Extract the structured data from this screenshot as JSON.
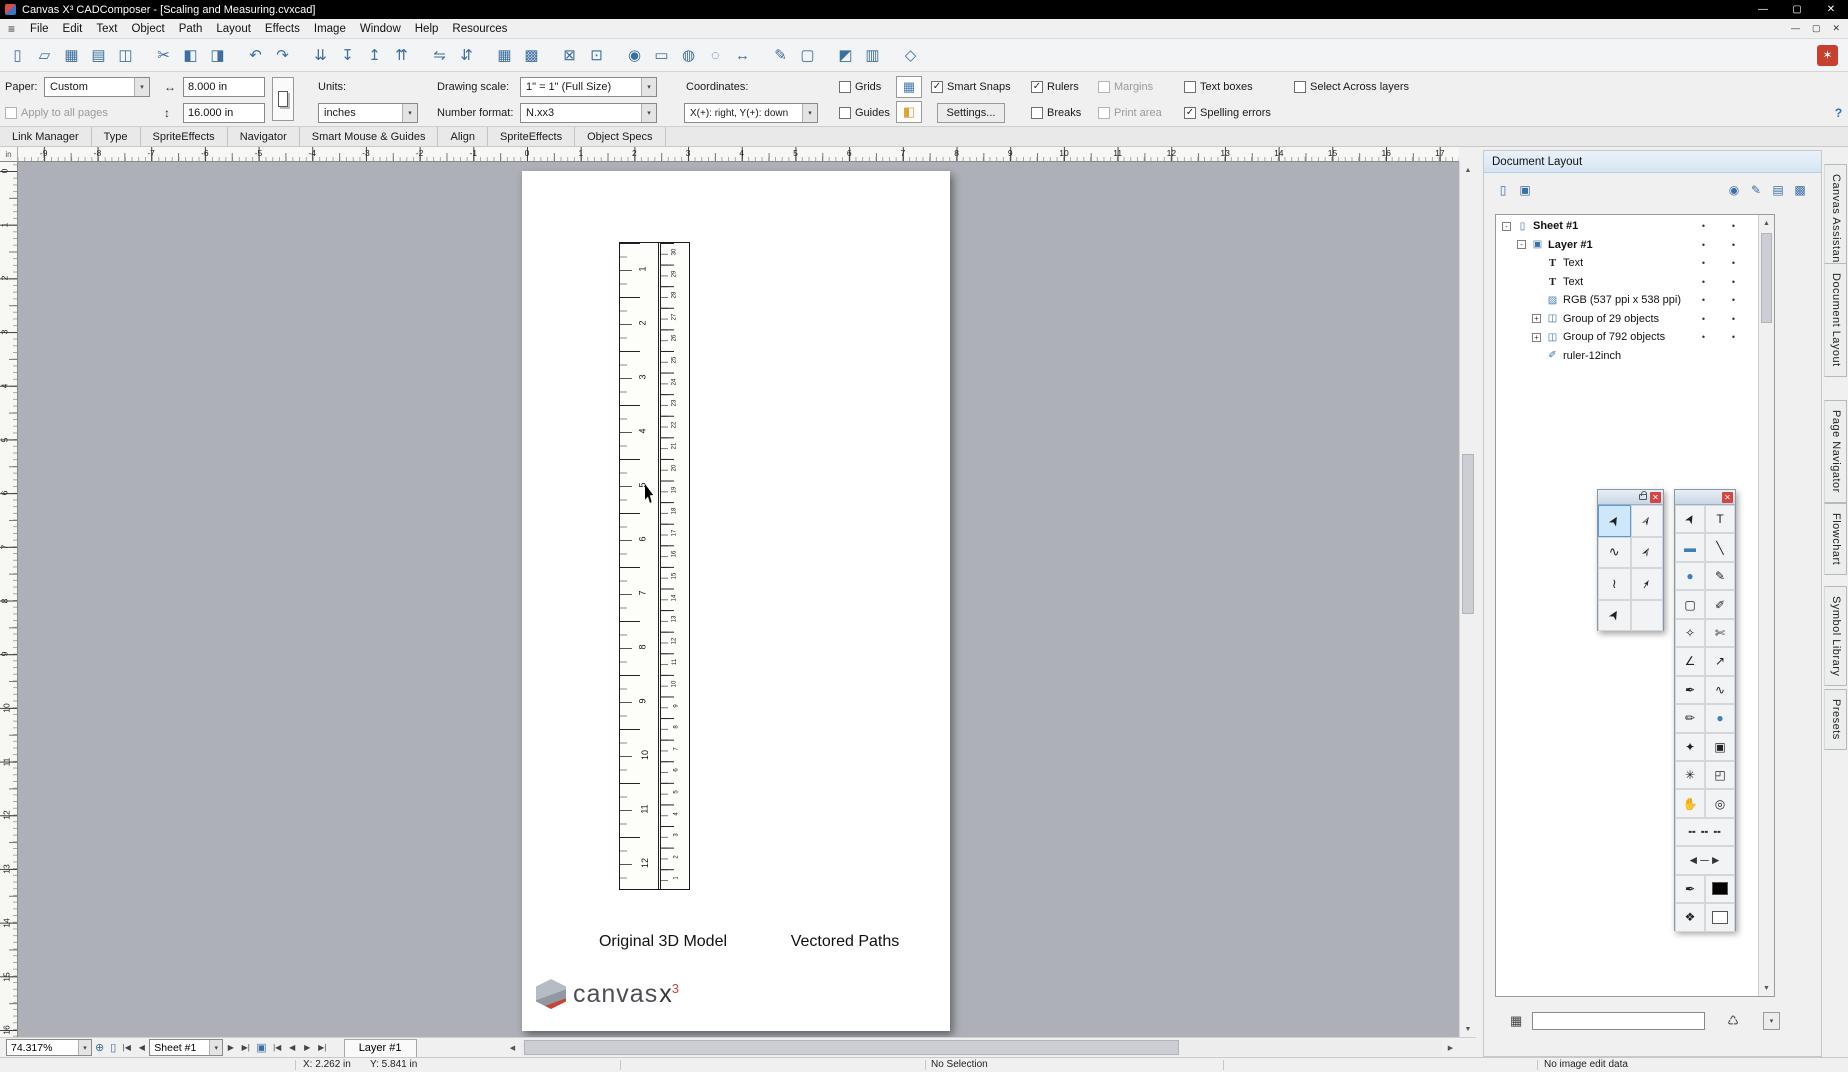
{
  "window": {
    "title": "Canvas X³ CADComposer - [Scaling and Measuring.cvxcad]",
    "controls": {
      "minimize": "—",
      "restore": "▢",
      "close": "✕"
    },
    "doc_controls": {
      "minimize": "—",
      "restore": "▢",
      "close": "✕"
    }
  },
  "menubar": {
    "hamburger": "≡",
    "items": [
      "File",
      "Edit",
      "Text",
      "Object",
      "Path",
      "Layout",
      "Effects",
      "Image",
      "Window",
      "Help",
      "Resources"
    ]
  },
  "toolbar": {
    "logo_glyph": "✶",
    "icons": [
      {
        "name": "new-document-icon",
        "glyph": "▯"
      },
      {
        "name": "open-file-icon",
        "glyph": "▱"
      },
      {
        "name": "save-icon",
        "glyph": "▦"
      },
      {
        "name": "print-icon",
        "glyph": "▤"
      },
      {
        "name": "print-preview-icon",
        "glyph": "◫"
      },
      {
        "name": "cut-icon",
        "glyph": "✂",
        "gap": true
      },
      {
        "name": "copy-icon",
        "glyph": "◧"
      },
      {
        "name": "paste-icon",
        "glyph": "◨"
      },
      {
        "name": "undo-icon",
        "glyph": "↶",
        "gap": true
      },
      {
        "name": "redo-icon",
        "glyph": "↷"
      },
      {
        "name": "send-to-back-icon",
        "glyph": "⇊",
        "gap": true
      },
      {
        "name": "send-backward-icon",
        "glyph": "↧"
      },
      {
        "name": "bring-forward-icon",
        "glyph": "↥"
      },
      {
        "name": "bring-to-front-icon",
        "glyph": "⇈"
      },
      {
        "name": "flip-horizontal-icon",
        "glyph": "⇋",
        "gap": true
      },
      {
        "name": "flip-vertical-icon",
        "glyph": "⇵"
      },
      {
        "name": "tile-horizontal-icon",
        "glyph": "▦",
        "gap": true
      },
      {
        "name": "tile-vertical-icon",
        "glyph": "▩"
      },
      {
        "name": "lock-icon",
        "glyph": "⊠",
        "gap": true
      },
      {
        "name": "unlock-icon",
        "glyph": "⊡"
      },
      {
        "name": "inspect-icon",
        "glyph": "◉",
        "gap": true
      },
      {
        "name": "select-area-icon",
        "glyph": "▭"
      },
      {
        "name": "fill-globe-icon",
        "glyph": "◍"
      },
      {
        "name": "zoom-area-icon",
        "glyph": "◌"
      },
      {
        "name": "fit-width-icon",
        "glyph": "↔"
      },
      {
        "name": "annotate-icon",
        "glyph": "✎",
        "gap": true
      },
      {
        "name": "screen-share-icon",
        "glyph": "▢"
      },
      {
        "name": "gradient-icon",
        "glyph": "◩",
        "gap": true
      },
      {
        "name": "chart-icon",
        "glyph": "▥"
      },
      {
        "name": "view-3d-icon",
        "glyph": "◇",
        "gap": true
      }
    ]
  },
  "properties": {
    "paper_label": "Paper:",
    "paper_value": "Custom",
    "width_icon": "↔",
    "height_icon": "↕",
    "width_value": "8.000 in",
    "height_value": "16.000 in",
    "apply_checkbox": {
      "label": "Apply to all pages",
      "checked": false,
      "disabled": true
    },
    "units_label": "Units:",
    "units_value": "inches",
    "scale_label": "Drawing scale:",
    "scale_value": "1\" = 1\"  (Full Size)",
    "format_label": "Number format:",
    "format_value": "N.xx3",
    "coords_label": "Coordinates:",
    "coords_value": "X(+): right, Y(+): down",
    "grid_icon": "▦",
    "snap_icon": "◧",
    "settings_label": "Settings...",
    "help_label": "?",
    "checkboxes_row1": [
      {
        "label": "Grids",
        "checked": false
      },
      {
        "label": "Smart Snaps",
        "checked": true
      },
      {
        "label": "Rulers",
        "checked": true
      },
      {
        "label": "Margins",
        "checked": false,
        "disabled": true
      },
      {
        "label": "Text boxes",
        "checked": false
      },
      {
        "label": "Select Across layers",
        "checked": false
      }
    ],
    "checkboxes_row2": [
      {
        "label": "Guides",
        "checked": false
      },
      {
        "label": "Breaks",
        "checked": false
      },
      {
        "label": "Print area",
        "checked": false,
        "disabled": true
      },
      {
        "label": "Spelling errors",
        "checked": true
      }
    ]
  },
  "palette_tabs": [
    "Link Manager",
    "Type",
    "SpriteEffects",
    "Navigator",
    "Smart Mouse & Guides",
    "Align",
    "SpriteEffects",
    "Object Specs"
  ],
  "rulers": {
    "unit": "in",
    "horizontal": [
      -9,
      -8,
      -7,
      -6,
      -5,
      -4,
      -3,
      -2,
      -1,
      0,
      1,
      2,
      3,
      4,
      5,
      6,
      7,
      8,
      9,
      10,
      11,
      12,
      13,
      14,
      15,
      16,
      17
    ],
    "vertical": [
      0,
      1,
      2,
      3,
      4,
      5,
      6,
      7,
      8,
      9,
      10,
      11,
      12,
      13,
      14,
      15,
      16
    ]
  },
  "canvas": {
    "captions": {
      "left": "Original 3D Model",
      "right": "Vectored Paths"
    },
    "logo": {
      "text": "canvas",
      "x": "x",
      "sup": "3"
    },
    "ruler_object": {
      "inches": [
        1,
        2,
        3,
        4,
        5,
        6,
        7,
        8,
        9,
        10,
        11,
        12
      ],
      "cm": [
        30,
        29,
        28,
        27,
        26,
        25,
        24,
        23,
        22,
        21,
        20,
        19,
        18,
        17,
        16,
        15,
        14,
        13,
        12,
        11,
        10,
        9,
        8,
        7,
        6,
        5,
        4,
        3,
        2,
        1
      ]
    }
  },
  "document_layout_panel": {
    "title": "Document Layout",
    "header_icons_left": [
      {
        "name": "new-item-icon",
        "glyph": "▯"
      },
      {
        "name": "duplicate-item-icon",
        "glyph": "▣"
      }
    ],
    "header_icons_right": [
      {
        "name": "visibility-icon",
        "glyph": "◉"
      },
      {
        "name": "edit-icon",
        "glyph": "✎"
      },
      {
        "name": "print-item-icon",
        "glyph": "▤"
      },
      {
        "name": "colors-icon",
        "glyph": "▩"
      }
    ],
    "icon_glyphs": {
      "sheet": "▯",
      "layer": "▣",
      "text": "T",
      "image": "▨",
      "group": "◫",
      "vector": "✐"
    },
    "tree": [
      {
        "label": "Sheet #1",
        "indent": 0,
        "icon": "sheet",
        "bold": true,
        "expander": "minus",
        "dots": true
      },
      {
        "label": "Layer #1",
        "indent": 1,
        "icon": "layer",
        "bold": true,
        "expander": "minus",
        "dots": true
      },
      {
        "label": "Text",
        "indent": 2,
        "icon": "text",
        "dots": true
      },
      {
        "label": "Text",
        "indent": 2,
        "icon": "text",
        "dots": true
      },
      {
        "label": "RGB (537 ppi x 538 ppi)",
        "indent": 2,
        "icon": "image",
        "dots": true
      },
      {
        "label": "Group of 29 objects",
        "indent": 2,
        "icon": "group",
        "expander": "plus",
        "dots": true
      },
      {
        "label": "Group of 792 objects",
        "indent": 2,
        "icon": "group",
        "expander": "plus",
        "dots": true
      },
      {
        "label": "ruler-12inch",
        "indent": 2,
        "icon": "vector",
        "dots": false
      }
    ]
  },
  "side_tabs": [
    "Canvas Assistant",
    "Document Layout",
    "Page Navigator",
    "Flowchart",
    "Symbol Library",
    "Presets"
  ],
  "palette_a": {
    "tools": [
      {
        "name": "selection-tool",
        "glyph": "➤",
        "active": true,
        "pointer": true
      },
      {
        "name": "group-selection-tool",
        "glyph": "➢",
        "pointer": true
      },
      {
        "name": "lasso-tool",
        "glyph": "∿"
      },
      {
        "name": "direct-selection-tool",
        "glyph": "➣",
        "pointer": true
      },
      {
        "name": "polygon-lasso-tool",
        "glyph": "≀"
      },
      {
        "name": "shape-edit-tool",
        "glyph": "➛",
        "pointer": true
      },
      {
        "name": "object-move-tool",
        "glyph": "➤",
        "pointer": true
      },
      {
        "name": "empty-cell",
        "glyph": ""
      }
    ]
  },
  "palette_b": {
    "tools": [
      {
        "name": "pointer-tool",
        "glyph": "➤",
        "pointer": true
      },
      {
        "name": "text-tool",
        "glyph": "T"
      },
      {
        "name": "rectangle-tool",
        "glyph": "▬",
        "blue": true
      },
      {
        "name": "line-tool",
        "glyph": "╲"
      },
      {
        "name": "ellipse-tool",
        "glyph": "●",
        "blue": true
      },
      {
        "name": "pencil-tool",
        "glyph": "✎"
      },
      {
        "name": "marquee-tool",
        "glyph": "▢"
      },
      {
        "name": "paintbrush-tool",
        "glyph": "✐"
      },
      {
        "name": "eyedropper-tool",
        "glyph": "✧"
      },
      {
        "name": "knife-tool",
        "glyph": "✄"
      },
      {
        "name": "polyline-tool",
        "glyph": "∠"
      },
      {
        "name": "measure-tool",
        "glyph": "↗"
      },
      {
        "name": "pen-tool",
        "glyph": "✒"
      },
      {
        "name": "curve-tool",
        "glyph": "∿"
      },
      {
        "name": "ink-pen-tool",
        "glyph": "✏"
      },
      {
        "name": "sphere-tool",
        "glyph": "●",
        "blue": true
      },
      {
        "name": "effects-tool",
        "glyph": "✦"
      },
      {
        "name": "camera-tool",
        "glyph": "▣"
      },
      {
        "name": "wand-tool",
        "glyph": "✳"
      },
      {
        "name": "puzzle-tool",
        "glyph": "◰"
      },
      {
        "name": "hand-tool",
        "glyph": "✋"
      },
      {
        "name": "zoom-tool",
        "glyph": "◎"
      },
      {
        "name": "dash-styles",
        "glyph": "╍ ╍ ╍",
        "wide": true
      },
      {
        "name": "arrowhead-styles",
        "glyph": "◄─►",
        "wide": true
      },
      {
        "name": "ink-bottle-tool",
        "glyph": "✒"
      },
      {
        "name": "stroke-color-swatch",
        "swatch": "black"
      },
      {
        "name": "fill-bucket-tool",
        "glyph": "❖"
      },
      {
        "name": "fill-color-swatch",
        "swatch": "white"
      }
    ]
  },
  "bottom_bar": {
    "zoom_value": "74.317%",
    "zoom_icon": "⊕",
    "page_icon": "▯",
    "nav_first": "|◀",
    "nav_prev": "◀",
    "nav_next": "▶",
    "nav_last": "▶|",
    "sheet_value": "Sheet #1",
    "duplicate_icon": "▣",
    "layer_tab": "Layer #1"
  },
  "scroll_icons": {
    "up": "▲",
    "down": "▼",
    "left": "◀",
    "right": "▶",
    "combo": "▾"
  },
  "status_bar": {
    "coords_x": "X: 2.262 in",
    "coords_y": "Y: 5.841 in",
    "selection": "No Selection",
    "image_info": "No image edit data"
  },
  "colors": {
    "accent_red": "#c5402f",
    "tool_blue": "#3c6e9f",
    "canvas_gray": "#adb1b7"
  }
}
